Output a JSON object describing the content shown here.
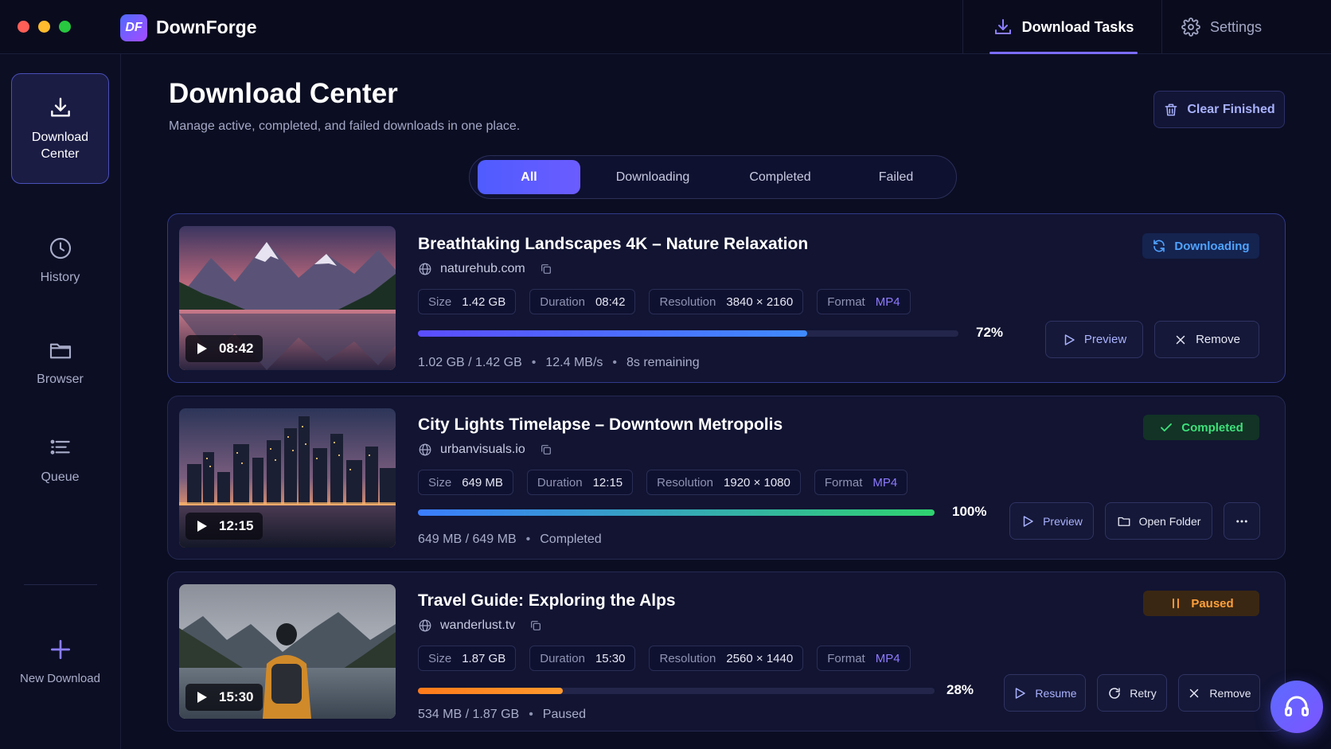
{
  "window": {
    "traffic_lights": [
      "close",
      "minimize",
      "maximize"
    ]
  },
  "app": {
    "logo_text": "DF",
    "title": "DownForge"
  },
  "topnav": [
    {
      "label": "Download Tasks",
      "icon": "download-icon",
      "active": true
    },
    {
      "label": "Settings",
      "icon": "gear-icon",
      "active": false
    }
  ],
  "sidebar": {
    "items": [
      {
        "label": "Download Center",
        "icon": "download-icon",
        "active": true
      },
      {
        "label": "History",
        "icon": "clock-icon"
      },
      {
        "label": "Browser",
        "icon": "folder-icon"
      },
      {
        "label": "Queue",
        "icon": "list-icon"
      }
    ],
    "new_download": {
      "label": "New Download",
      "icon": "plus-icon"
    }
  },
  "header": {
    "title": "Download Center",
    "subtitle": "Manage active, completed, and failed downloads in one place.",
    "clear_label": "Clear Finished"
  },
  "tabs": [
    {
      "label": "All",
      "active": true
    },
    {
      "label": "Downloading"
    },
    {
      "label": "Completed"
    },
    {
      "label": "Failed"
    }
  ],
  "labels": {
    "size": "Size",
    "duration": "Duration",
    "resolution": "Resolution",
    "format": "Format"
  },
  "downloads": [
    {
      "title": "Breathtaking Landscapes 4K – Nature Relaxation",
      "source": "naturehub.com",
      "duration_badge": "08:42",
      "size": "1.42 GB",
      "duration": "08:42",
      "resolution": "3840 × 2160",
      "format": "MP4",
      "progress": 0.72,
      "progress_label": "72%",
      "transferred": "1.02 GB / 1.42 GB",
      "speed": "12.4 MB/s",
      "eta": "8s remaining",
      "status": "Downloading",
      "status_color": "#4fa3ff",
      "actions": [
        "Preview",
        "Remove"
      ]
    },
    {
      "title": "City Lights Timelapse – Downtown Metropolis",
      "source": "urbanvisuals.io",
      "duration_badge": "12:15",
      "size": "649 MB",
      "duration": "12:15",
      "resolution": "1920 × 1080",
      "format": "MP4",
      "progress": 1.0,
      "progress_label": "100%",
      "transferred": "649 MB / 649 MB",
      "state_text": "Completed",
      "status": "Completed",
      "status_color": "#3ee07a",
      "actions": [
        "Preview",
        "Open Folder"
      ]
    },
    {
      "title": "Travel Guide: Exploring the Alps",
      "source": "wanderlust.tv",
      "duration_badge": "15:30",
      "size": "1.87 GB",
      "duration": "15:30",
      "resolution": "2560 × 1440",
      "format": "MP4",
      "progress": 0.28,
      "progress_label": "28%",
      "transferred": "534 MB / 1.87 GB",
      "state_text": "Paused",
      "status": "Paused",
      "status_color": "#ffa03a",
      "actions": [
        "Resume",
        "Retry",
        "Remove"
      ]
    }
  ],
  "support_button": {
    "icon": "headset-icon"
  }
}
